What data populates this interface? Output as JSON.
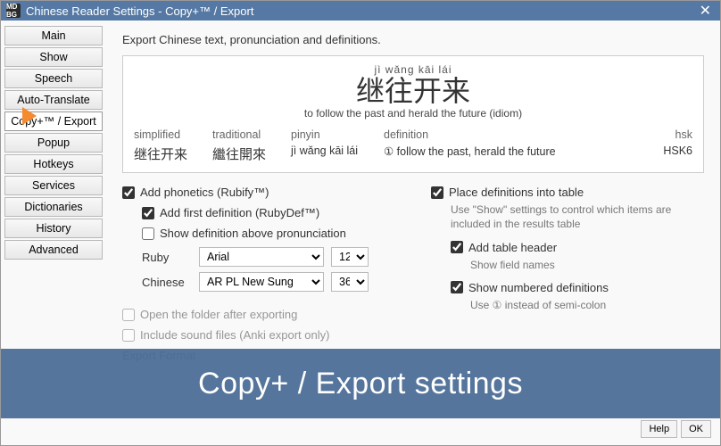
{
  "titlebar": {
    "icon_text": "MD BG",
    "title": "Chinese Reader Settings - Copy+™ / Export"
  },
  "sidebar": {
    "items": [
      "Main",
      "Show",
      "Speech",
      "Auto-Translate",
      "Copy+™ / Export",
      "Popup",
      "Hotkeys",
      "Services",
      "Dictionaries",
      "History",
      "Advanced"
    ],
    "active_index": 4
  },
  "content": {
    "description": "Export Chinese text, pronunciation and definitions.",
    "preview": {
      "pinyin": "jì wǎng kāi lái",
      "hanzi": "继往开来",
      "definition_line": "to follow the past and herald the future (idiom)",
      "headers": {
        "simplified": "simplified",
        "traditional": "traditional",
        "pinyin": "pinyin",
        "definition": "definition",
        "hsk": "hsk"
      },
      "row": {
        "simplified": "继往开来",
        "traditional": "繼往開來",
        "pinyin": "jì wǎng kāi lái",
        "definition": "① follow the past, herald the future",
        "hsk": "HSK6"
      }
    },
    "left": {
      "add_phonetics": "Add phonetics (Rubify™)",
      "add_first_def": "Add first definition (RubyDef™)",
      "show_def_above": "Show definition above pronunciation",
      "ruby_label": "Ruby",
      "chinese_label": "Chinese",
      "ruby_font": "Arial",
      "ruby_size": "12",
      "chinese_font": "AR PL New Sung",
      "chinese_size": "36",
      "open_folder": "Open the folder after exporting",
      "include_sound": "Include sound files (Anki export only)",
      "export_format": "Export Format"
    },
    "right": {
      "place_table": "Place definitions into table",
      "place_table_hint": "Use \"Show\" settings to control which items are included in the results table",
      "add_header": "Add table header",
      "add_header_hint": "Show field names",
      "numbered": "Show numbered definitions",
      "numbered_hint": "Use ① instead of semi-colon"
    }
  },
  "footer": {
    "help": "Help",
    "ok": "OK"
  },
  "banner": "Copy+ / Export settings"
}
